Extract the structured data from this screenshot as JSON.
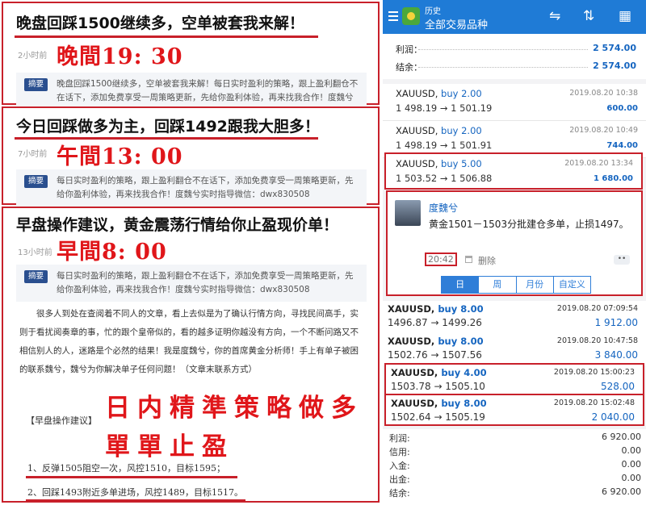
{
  "left": {
    "sections": [
      {
        "headline": "晚盘回踩1500继续多，空单被套我来解！",
        "time_ago": "2小时前",
        "stamp": "晚間19: 30",
        "summary_tag": "摘要",
        "summary": "晚盘回踩1500继续多，空单被套我来解！每日实时盈利的策略，跟上盈利翻仓不在话下，添加免费享受一周策略更新，先给你盈利体验，再来找我合作！度魏兮实时指导微信：dwx830508"
      },
      {
        "headline": "今日回踩做多为主，回踩1492跟我大胆多！",
        "time_ago": "7小时前",
        "stamp": "午間13: 00",
        "summary_tag": "摘要",
        "summary": "每日实时盈利的策略，跟上盈利翻仓不在话下，添加免费享受一周策略更新，先给你盈利体验，再来找我合作！度魏兮实时指导微信：dwx830508"
      },
      {
        "headline": "早盘操作建议，黄金震荡行情给你止盈现价单！",
        "time_ago": "13小时前",
        "stamp": "早間8: 00",
        "summary_tag": "摘要",
        "summary": "每日实时盈利的策略，跟上盈利翻仓不在话下，添加免费享受一周策略更新，先给你盈利体验，再来找我合作！度魏兮实时指导微信：dwx830508"
      }
    ],
    "article": "很多人到处在查阅着不同人的文章，看上去似是为了确认行情方向，寻找民间高手，实则于看扰阅奏章的事，忙的跟个皇帝似的，看的越多证明你越没有方向，一个不断问路又不相信别人的人，迷路是个必然的结果！我是度魏兮，你的首席黄金分析师！手上有单子被困的联系魏兮，魏兮为你解决单子任何问题！（文章末联系方式）",
    "plan_title": "【早盘操作建议】",
    "big_red_1": "日内精準策略做多",
    "big_red_2": "單單止盈",
    "plan_items": [
      "1、反弹1505阻空一次，风控1510，目标1595；",
      "2、回踩1493附近多单进场，风控1489，目标1517。"
    ]
  },
  "right": {
    "appbar": {
      "subtitle": "历史",
      "title": "全部交易品种"
    },
    "profit_label": "利润：",
    "profit_value": "2 574.00",
    "balance_label": "结余：",
    "balance_value": "2 574.00",
    "trades": [
      {
        "sym": "XAUUSD,",
        "side": "buy 2.00",
        "date": "2019.08.20 10:38",
        "prices": "1 498.19 → 1 501.19",
        "pnl": "600.00"
      },
      {
        "sym": "XAUUSD,",
        "side": "buy 2.00",
        "date": "2019.08.20 10:49",
        "prices": "1 498.19 → 1 501.91",
        "pnl": "744.00"
      },
      {
        "sym": "XAUUSD,",
        "side": "buy 5.00",
        "date": "2019.08.20 13:34",
        "prices": "1 503.52 → 1 506.88",
        "pnl": "1 680.00"
      }
    ],
    "comment": {
      "name": "度魏兮",
      "text": "黄金1501－1503分批建仓多单，止损1497。",
      "time": "20:42",
      "delete": "删除",
      "more": "••",
      "tabs": [
        "日",
        "周",
        "月份",
        "自定义"
      ]
    },
    "trades2": [
      {
        "sym": "XAUUSD,",
        "side": "buy 8.00",
        "date": "2019.08.20 07:09:54",
        "prices": "1496.87 → 1499.26",
        "pnl": "1 912.00"
      },
      {
        "sym": "XAUUSD,",
        "side": "buy 8.00",
        "date": "2019.08.20 10:47:58",
        "prices": "1502.76 → 1507.56",
        "pnl": "3 840.00"
      },
      {
        "sym": "XAUUSD,",
        "side": "buy 4.00",
        "date": "2019.08.20 15:00:23",
        "prices": "1503.78 → 1505.10",
        "pnl": "528.00"
      },
      {
        "sym": "XAUUSD,",
        "side": "buy 8.00",
        "date": "2019.08.20 15:02:48",
        "prices": "1502.64 → 1505.19",
        "pnl": "2 040.00"
      }
    ],
    "totals": [
      {
        "label": "利润:",
        "value": "6 920.00"
      },
      {
        "label": "信用:",
        "value": "0.00"
      },
      {
        "label": "入金:",
        "value": "0.00"
      },
      {
        "label": "出金:",
        "value": "0.00"
      },
      {
        "label": "结余:",
        "value": "6 920.00"
      }
    ]
  }
}
